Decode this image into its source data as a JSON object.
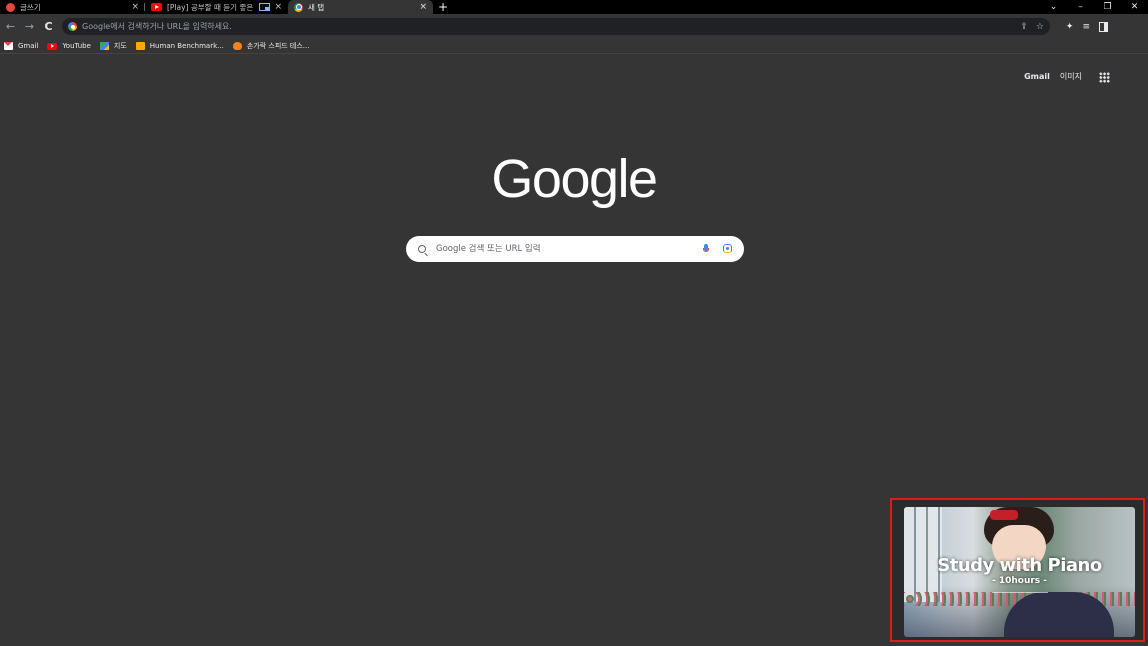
{
  "tabs": [
    {
      "title": "글쓰기",
      "close": "×"
    },
    {
      "title": "[Play] 공부할 때 듣기 좋은  ",
      "close": "×"
    },
    {
      "title": "새 탭",
      "close": "×"
    }
  ],
  "new_tab_label": "+",
  "window_controls": {
    "dropdown": "⌄",
    "minimize": "–",
    "restore": "❐",
    "close": "✕"
  },
  "nav": {
    "back": "←",
    "forward": "→",
    "reload": "C"
  },
  "omnibox": {
    "placeholder": "Google에서 검색하거나 URL을 입력하세요.",
    "share": "⇪",
    "star": "☆"
  },
  "toolbar_icons": {
    "extensions": "✦",
    "media": "≡"
  },
  "bookmarks": [
    {
      "label": "Gmail"
    },
    {
      "label": "YouTube"
    },
    {
      "label": "지도"
    },
    {
      "label": "Human Benchmark..."
    },
    {
      "label": "손가락 스피드 테스..."
    }
  ],
  "top_links": {
    "gmail": "Gmail",
    "images": "이미지"
  },
  "logo_text": "Google",
  "search": {
    "placeholder": "Google 검색 또는 URL 입력"
  },
  "pip": {
    "title": "Study with Piano",
    "subtitle": "- 10hours -",
    "border_color": "#e01b1b"
  },
  "colors": {
    "page_bg": "#353535",
    "tabstrip_bg": "#000000",
    "omnibox_bg": "#202124"
  }
}
